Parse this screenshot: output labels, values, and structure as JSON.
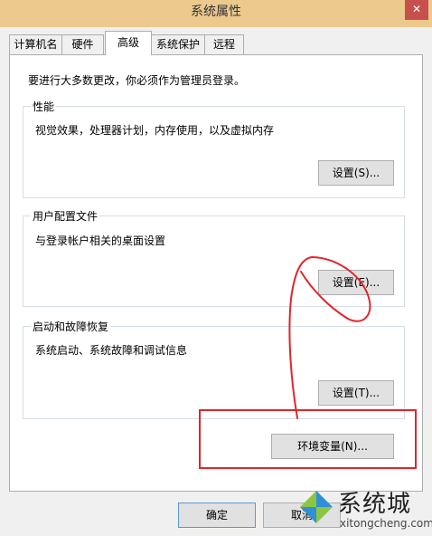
{
  "window": {
    "title": "系统属性",
    "close_glyph": "✕"
  },
  "tabs": [
    {
      "label": "计算机名",
      "active": false
    },
    {
      "label": "硬件",
      "active": false
    },
    {
      "label": "高级",
      "active": true
    },
    {
      "label": "系统保护",
      "active": false
    },
    {
      "label": "远程",
      "active": false
    }
  ],
  "advanced": {
    "admin_note": "要进行大多数更改，你必须作为管理员登录。",
    "performance": {
      "title": "性能",
      "description": "视觉效果，处理器计划，内存使用，以及虚拟内存",
      "settings_label": "设置(S)..."
    },
    "user_profiles": {
      "title": "用户配置文件",
      "description": "与登录帐户相关的桌面设置",
      "settings_label": "设置(E)..."
    },
    "startup_recovery": {
      "title": "启动和故障恢复",
      "description": "系统启动、系统故障和调试信息",
      "settings_label": "设置(T)..."
    },
    "env_vars_label": "环境变量(N)..."
  },
  "footer": {
    "ok_label": "确定",
    "cancel_label": "取消"
  },
  "watermark": {
    "name_cn": "系统城",
    "domain": "xitongcheng.com"
  },
  "colors": {
    "titlebar": "#ecc98d",
    "close": "#c7504d",
    "annotation_red": "#e0262b",
    "focus_blue": "#5a98d6"
  }
}
